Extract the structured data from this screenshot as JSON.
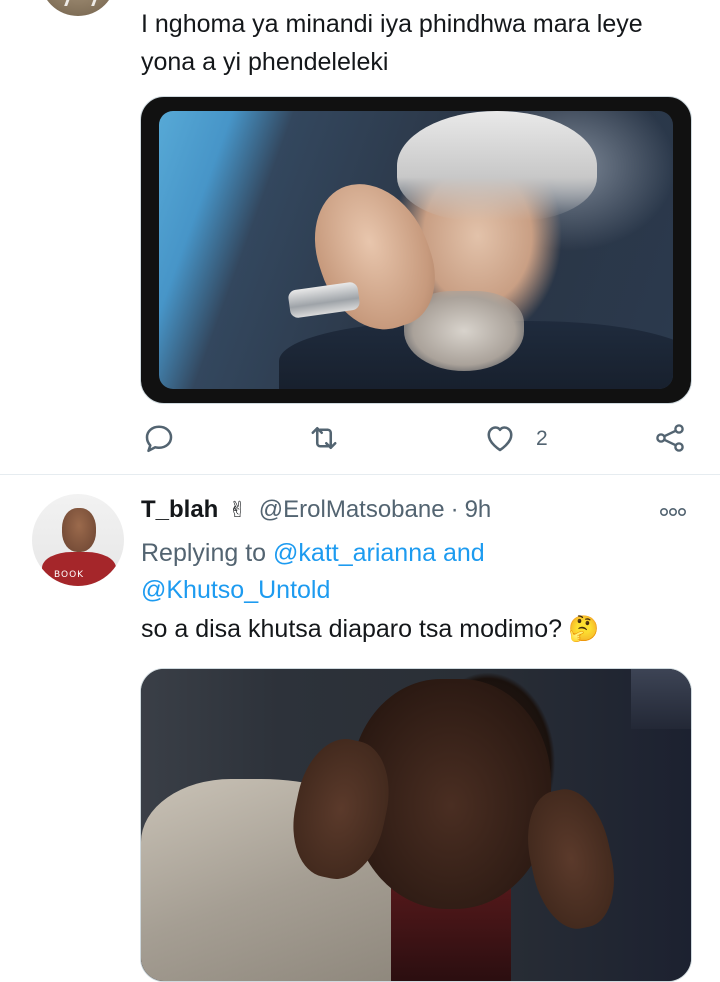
{
  "tweet1": {
    "text": "I nghoma ya minandi iya phindhwa mara leye yona a yi phendeleleki",
    "like_count": "2"
  },
  "tweet2": {
    "display_name": "T_blah",
    "name_emoji": "✌",
    "handle": "@ErolMatsobane",
    "separator": "·",
    "time": "9h",
    "replying_prefix": "Replying to ",
    "replying_users": [
      "@katt_arianna",
      "@Khutso_Untold"
    ],
    "replying_joiner": " and",
    "text": "so a disa khutsa diaparo tsa modimo?",
    "text_emoji": "🤔",
    "avatar_shirt_text": "BOOK"
  },
  "colors": {
    "text": "#14171a",
    "secondary": "#536471",
    "link": "#1d9bf0",
    "divider": "#e6ecf0"
  },
  "icons": [
    "reply-icon",
    "retweet-icon",
    "like-icon",
    "share-icon",
    "more-icon"
  ]
}
